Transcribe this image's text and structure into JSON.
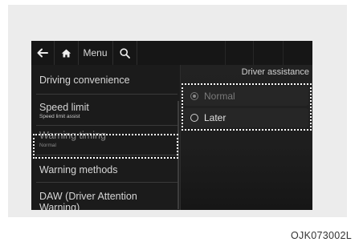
{
  "topbar": {
    "back_icon": "arrow-left-icon",
    "home_icon": "home-icon",
    "menu_label": "Menu",
    "search_icon": "search-icon"
  },
  "left_menu": {
    "items": [
      {
        "label": "Driving convenience",
        "sub": ""
      },
      {
        "label": "Speed limit",
        "sub": "Speed limit assist"
      },
      {
        "label": "Warning timing",
        "sub": "Normal"
      },
      {
        "label": "Warning methods",
        "sub": ""
      },
      {
        "label": "DAW (Driver Attention Warning)",
        "sub": ""
      }
    ]
  },
  "right_panel": {
    "title": "Driver assistance",
    "options": [
      {
        "label": "Normal",
        "selected": true
      },
      {
        "label": "Later",
        "selected": false
      }
    ]
  },
  "caption": "OJK073002L",
  "colors": {
    "screen_bg": "#121212",
    "highlight_dots": "#ffffff",
    "frame_bg": "#ececec"
  }
}
